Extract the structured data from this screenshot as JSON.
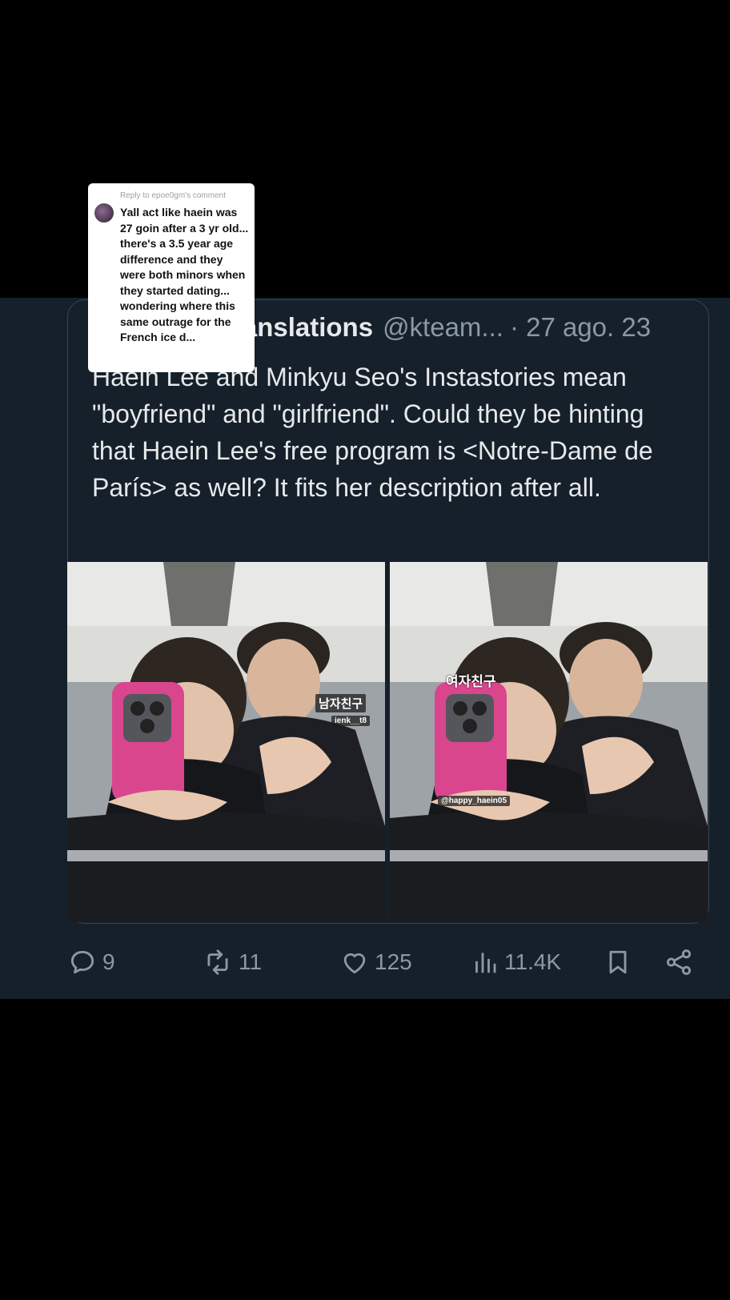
{
  "tweet": {
    "author_name": "ranslations",
    "author_handle": "@kteam...",
    "date": "· 27 ago. 23",
    "text": "Haein Lee and Minkyu Seo's Instastories mean \"boyfriend\" and \"girlfriend\". Could they be hinting that Haein Lee's free program is <Notre-Dame de París> as well? It fits her description after all.",
    "photos": {
      "left": {
        "tag_korean": "남자친구",
        "tag_handle": "ienk__t8"
      },
      "right": {
        "tag_korean": "여자친구",
        "tag_handle": "@happy_haein05"
      }
    }
  },
  "actions": {
    "replies": "9",
    "retweets": "11",
    "likes": "125",
    "views": "11.4K"
  },
  "reply_overlay": {
    "header": "Reply to epoe0gm's comment",
    "text": "Yall act like haein was 27 goin after a 3 yr old... there's a 3.5 year age difference and they were both minors when they started dating... wondering where this same outrage for the French ice d..."
  },
  "colors": {
    "background": "#000000",
    "tweet_background": "#15202b",
    "text_primary": "#e7e9ea",
    "text_secondary": "#8b98a5",
    "border": "#38444d"
  },
  "icons": [
    "reply-icon",
    "retweet-icon",
    "like-icon",
    "views-icon",
    "bookmark-icon",
    "share-icon"
  ]
}
